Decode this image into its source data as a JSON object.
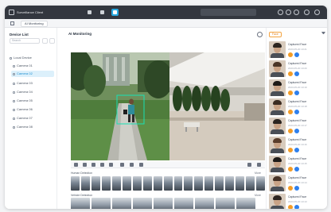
{
  "colors": {
    "accent": "#27a9e1",
    "titlebar": "#33373f",
    "badge_orange": "#f39c26",
    "badge_blue": "#2f80ed"
  },
  "titlebar": {
    "app_label": "Surveillance Client"
  },
  "tabbar": {
    "tab_label": "AI Monitoring"
  },
  "sidebar": {
    "title": "Device List",
    "search_placeholder": "Search",
    "items": [
      {
        "label": "Local Device"
      },
      {
        "label": "Camera 01"
      },
      {
        "label": "Camera 02"
      },
      {
        "label": "Camera 03"
      },
      {
        "label": "Camera 04"
      },
      {
        "label": "Camera 05"
      },
      {
        "label": "Camera 06"
      },
      {
        "label": "Camera 07"
      },
      {
        "label": "Camera 08"
      }
    ]
  },
  "main": {
    "title": "AI Monitoring",
    "strip_people_label": "Human Detection",
    "strip_vehicles_label": "Vehicle Detection",
    "strip_more": "More"
  },
  "right_panel": {
    "filter_label": "Face",
    "cards": [
      {
        "name": "Captured Face",
        "sub": "2023-05-20 10:21"
      },
      {
        "name": "Captured Face",
        "sub": "2023-05-20 10:20"
      },
      {
        "name": "Captured Face",
        "sub": "2023-05-20 10:19"
      },
      {
        "name": "Captured Face",
        "sub": "2023-05-20 10:18"
      },
      {
        "name": "Captured Face",
        "sub": "2023-05-20 10:17"
      },
      {
        "name": "Captured Face",
        "sub": "2023-05-20 10:16"
      },
      {
        "name": "Captured Face",
        "sub": "2023-05-20 10:15"
      },
      {
        "name": "Captured Face",
        "sub": "2023-05-20 10:14"
      },
      {
        "name": "Captured Face",
        "sub": "2023-05-20 10:13"
      }
    ]
  }
}
